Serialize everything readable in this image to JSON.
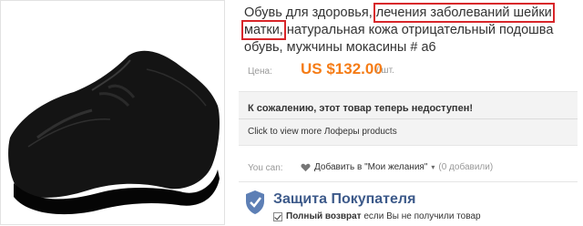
{
  "product": {
    "title_part1": "Обувь для здоровья, ",
    "title_highlight": "лечения заболеваний шейки матки,",
    "title_part2": " натуральная кожа отрицательный подошва обувь, мужчины мокасины # a6",
    "price_label": "Цена:",
    "price": "US $132.00",
    "unit": "/ шт."
  },
  "notice": {
    "unavailable": "К сожалению, этот товар теперь недоступен!",
    "view_more": "Click to view more Лоферы products"
  },
  "actions": {
    "you_can": "You can:",
    "wishlist_label": "Добавить в \"Мои желания\"",
    "wishlist_count": "(0 добавили)"
  },
  "protection": {
    "title": "Защита Покупателя",
    "line_strong": "Полный возврат",
    "line_rest": " если Вы не получили товар"
  },
  "colors": {
    "price": "#f57c16",
    "highlight": "#d8262a",
    "protection": "#3d5a8a"
  }
}
